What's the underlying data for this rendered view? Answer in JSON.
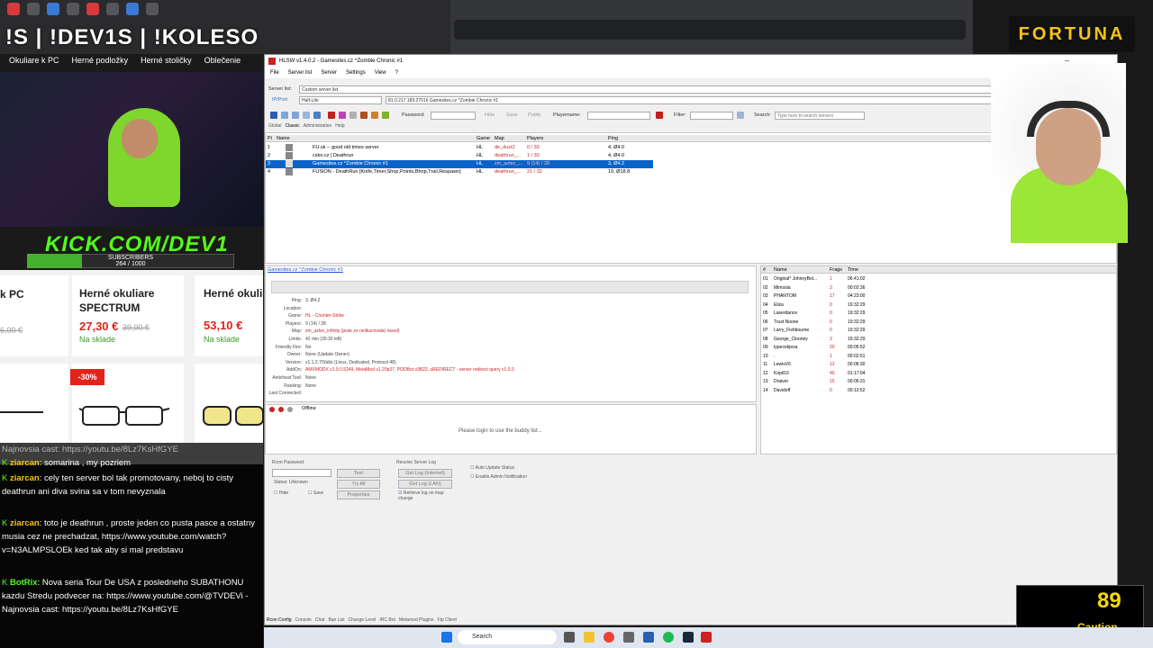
{
  "stream": {
    "title": "!S | !DEV1S | !KOLESO",
    "links": [
      "Okuliare k PC",
      "Herné podložky",
      "Herné stoličky",
      "Oblečenie"
    ],
    "kick": "KICK.COM/DEV1",
    "subs_label": "SUBSCRIBERS",
    "subs_count": "264 / 1000",
    "subs_progress": 0.264
  },
  "shop": {
    "items": [
      {
        "name": "k PC",
        "price": "",
        "old": "6,00 €",
        "stock": ""
      },
      {
        "name": "Herné okuliare SPECTRUM",
        "price": "27,30 €",
        "old": "39,00 €",
        "stock": "Na sklade"
      },
      {
        "name": "Herné okuliare WALLHACK",
        "price": "53,10 €",
        "old": "",
        "stock": "Na sklade"
      }
    ],
    "badge": "-30%"
  },
  "chat": [
    {
      "user": "",
      "text": "Najnovsia cast: https://youtu.be/8Lz7KsHfGYE"
    },
    {
      "user": "ziarcan",
      "text": ": somarina , my pozriem"
    },
    {
      "user": "ziarcan",
      "text": ": cely ten server bol tak promotovany, neboj to cisty deathrun ani diva svina sa v tom nevyznala"
    },
    {
      "user": "ziarcan",
      "text": ": toto je deathrun , proste jeden co pusta pasce a ostatny musia cez ne prechadzat, https://www.youtube.com/watch?v=N3ALMPSLOEk ked tak aby si mal predstavu"
    },
    {
      "user": "BotRix",
      "text": ": Nova seria Tour De USA z posledneho SUBATHONU kazdu Stredu podvecer na: https://www.youtube.com/@TVDEVi - Najnovsia cast: https://youtu.be/8Lz7KsHfGYE"
    }
  ],
  "app": {
    "title": "HLSW v1.4.0.2 - Gamesites.cz ^Zombie Chronic #1",
    "menu": [
      "File",
      "Server list",
      "Server",
      "Settings",
      "View",
      "?"
    ],
    "server_list_label": "Server list:",
    "server_list_value": "Custom server list",
    "ip_label": "IP/Port:",
    "game_value": "Half-Life",
    "address_value": "81.0.217.183:27016 Gamesites.cz ^Zombie Chronic #1",
    "password_label": "Password:",
    "hide_label": "Hide",
    "save_label": "Save",
    "public_label": "Public",
    "playername_label": "Playername:",
    "filter_label": "Filter:",
    "search_label": "Search:",
    "search_placeholder": "Type here to search servers",
    "tabs": [
      "Global",
      "Classic",
      "Administration",
      "Help"
    ],
    "columns": [
      "Pi",
      "Name",
      "Game",
      "Map",
      "Players",
      "Ping"
    ],
    "servers": [
      {
        "n": "1",
        "name": "FU.sk -- good old times server",
        "game": "HL",
        "map": "de_dust2",
        "players": "0 / 30",
        "ping": "4, Ø4.0"
      },
      {
        "n": "2",
        "name": "csko.cz | Deathrun",
        "game": "HL",
        "map": "deathrun_...",
        "players": "1 / 30",
        "ping": "4, Ø4.0"
      },
      {
        "n": "3",
        "name": "Gamesites.cz ^Zombie Chronic #1",
        "game": "HL",
        "map": "zm_aztec_...",
        "players": "9 (14) / 28",
        "ping": "3, Ø4.2"
      },
      {
        "n": "4",
        "name": "FUSION - DeathRun [Knife,Timer,Shop,Points,Bhop,Trail,Respawn]",
        "game": "HL",
        "map": "deathrun_...",
        "players": "21 / 32",
        "ping": "19, Ø18.8"
      }
    ],
    "details": {
      "server_link": "Gamesites.cz ^Zombie Chronic #1",
      "rows": [
        {
          "label": "Ping:",
          "value": "3, Ø4.2"
        },
        {
          "label": "Location:",
          "value": ""
        },
        {
          "label": "Game:",
          "value": "HL - Counter-Strike"
        },
        {
          "label": "Players:",
          "value": "9 (14) / 28"
        },
        {
          "label": "Map:",
          "value": "zm_aztec_infinity (jeste ze nelikacovala) neeel)"
        },
        {
          "label": "Limits:",
          "value": "42 min (35:30 left)"
        },
        {
          "label": "Friendly Fire:",
          "value": "No"
        },
        {
          "label": "Owner:",
          "value": "None (Update Owner)"
        },
        {
          "label": "Version:",
          "value": "v1.1.2.7/Stdio (Linux, Dedicated, Protocol 48)"
        },
        {
          "label": "AddOn:",
          "value": "AMXMODX v1.9.0.5249, MetaMod v1.20p37, PODBot v3B22, sREDIRECT - server redirect query v1.0.3"
        },
        {
          "label": "Anticheat Tool:",
          "value": "None"
        },
        {
          "label": "Ranking:",
          "value": "None"
        },
        {
          "label": "Last Connected:",
          "value": ""
        }
      ]
    },
    "players_columns": [
      "#",
      "Name",
      "Frags",
      "Time"
    ],
    "players": [
      {
        "n": "01",
        "name": "Original* JohnnyBol...",
        "frags": "1",
        "time": "06:41:02"
      },
      {
        "n": "02",
        "name": "Mimosla",
        "frags": "3",
        "time": "00:02:36"
      },
      {
        "n": "03",
        "name": "PHANTOM",
        "frags": "17",
        "time": "04:23:00"
      },
      {
        "n": "04",
        "name": "Eliza",
        "frags": "0",
        "time": "19:32:29"
      },
      {
        "n": "05",
        "name": "Laserdance",
        "frags": "0",
        "time": "19:32:29"
      },
      {
        "n": "06",
        "name": "Trust Noone",
        "frags": "0",
        "time": "19:32:29"
      },
      {
        "n": "07",
        "name": "Larry_Fishbourne",
        "frags": "0",
        "time": "19:32:29"
      },
      {
        "n": "08",
        "name": "George_Clooney",
        "frags": "3",
        "time": "19:32:29"
      },
      {
        "n": "09",
        "name": "typecekjesa",
        "frags": "20",
        "time": "00:05:52"
      },
      {
        "n": "10",
        "name": ".",
        "frags": "1",
        "time": "00:02:51"
      },
      {
        "n": "11",
        "name": "LewisV6",
        "frags": "12",
        "time": "00:06:30"
      },
      {
        "n": "12",
        "name": "Kopil10",
        "frags": "40",
        "time": "01:17:04"
      },
      {
        "n": "13",
        "name": "Draiver",
        "frags": "15",
        "time": "00:06:31"
      },
      {
        "n": "14",
        "name": "Davidoff",
        "frags": "0",
        "time": "00:12:52"
      }
    ],
    "buddy_status": "Offline",
    "buddy_message": "Please login to use the buddy list...",
    "rcon_password_label": "Rcon Password",
    "status_label": "Status: Unknown",
    "test_btn": "Test",
    "try_all_btn": "Try All",
    "properties_btn": "Properties",
    "hide_cb": "Hide",
    "save_cb": "Save",
    "receive_log_label": "Receive Server Log",
    "get_log_internet": "Get Log (Internet)",
    "get_log_lan": "Get Log (LAN)",
    "retrieve_log": "Retrieve log on map change",
    "auto_update": "Auto Update Status",
    "admin_notify": "Enable Admin Notification",
    "bottom_tabs": [
      "Rcon Config",
      "Console",
      "Chat",
      "Ban List",
      "Change Level",
      "IRC Bot",
      "Metamod Plugins",
      "Ftp Client"
    ]
  },
  "sponsor": "FORTUNA",
  "caution": {
    "value": "89",
    "label": "Caution"
  },
  "taskbar_search": "Search"
}
